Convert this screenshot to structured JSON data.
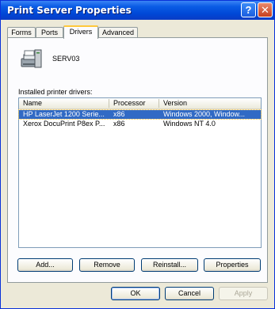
{
  "window": {
    "title": "Print Server Properties"
  },
  "titlebar_buttons": {
    "help": "?",
    "close": "✕"
  },
  "tabs": [
    {
      "label": "Forms"
    },
    {
      "label": "Ports"
    },
    {
      "label": "Drivers",
      "active": true
    },
    {
      "label": "Advanced"
    }
  ],
  "server": {
    "name": "SERV03"
  },
  "drivers": {
    "label": "Installed printer drivers:",
    "columns": [
      "Name",
      "Processor",
      "Version"
    ],
    "rows": [
      {
        "name": "HP LaserJet 1200 Serie...",
        "processor": "x86",
        "version": "Windows 2000, Window...",
        "selected": true
      },
      {
        "name": "Xerox DocuPrint P8ex P...",
        "processor": "x86",
        "version": "Windows NT 4.0",
        "selected": false
      }
    ]
  },
  "buttons": {
    "add": "Add...",
    "remove": "Remove",
    "reinstall": "Reinstall...",
    "properties": "Properties",
    "ok": "OK",
    "cancel": "Cancel",
    "apply": "Apply"
  },
  "colors": {
    "titlebar": "#0a5ce5",
    "selection": "#316ac5",
    "active_tab_accent": "#ffc83c"
  }
}
